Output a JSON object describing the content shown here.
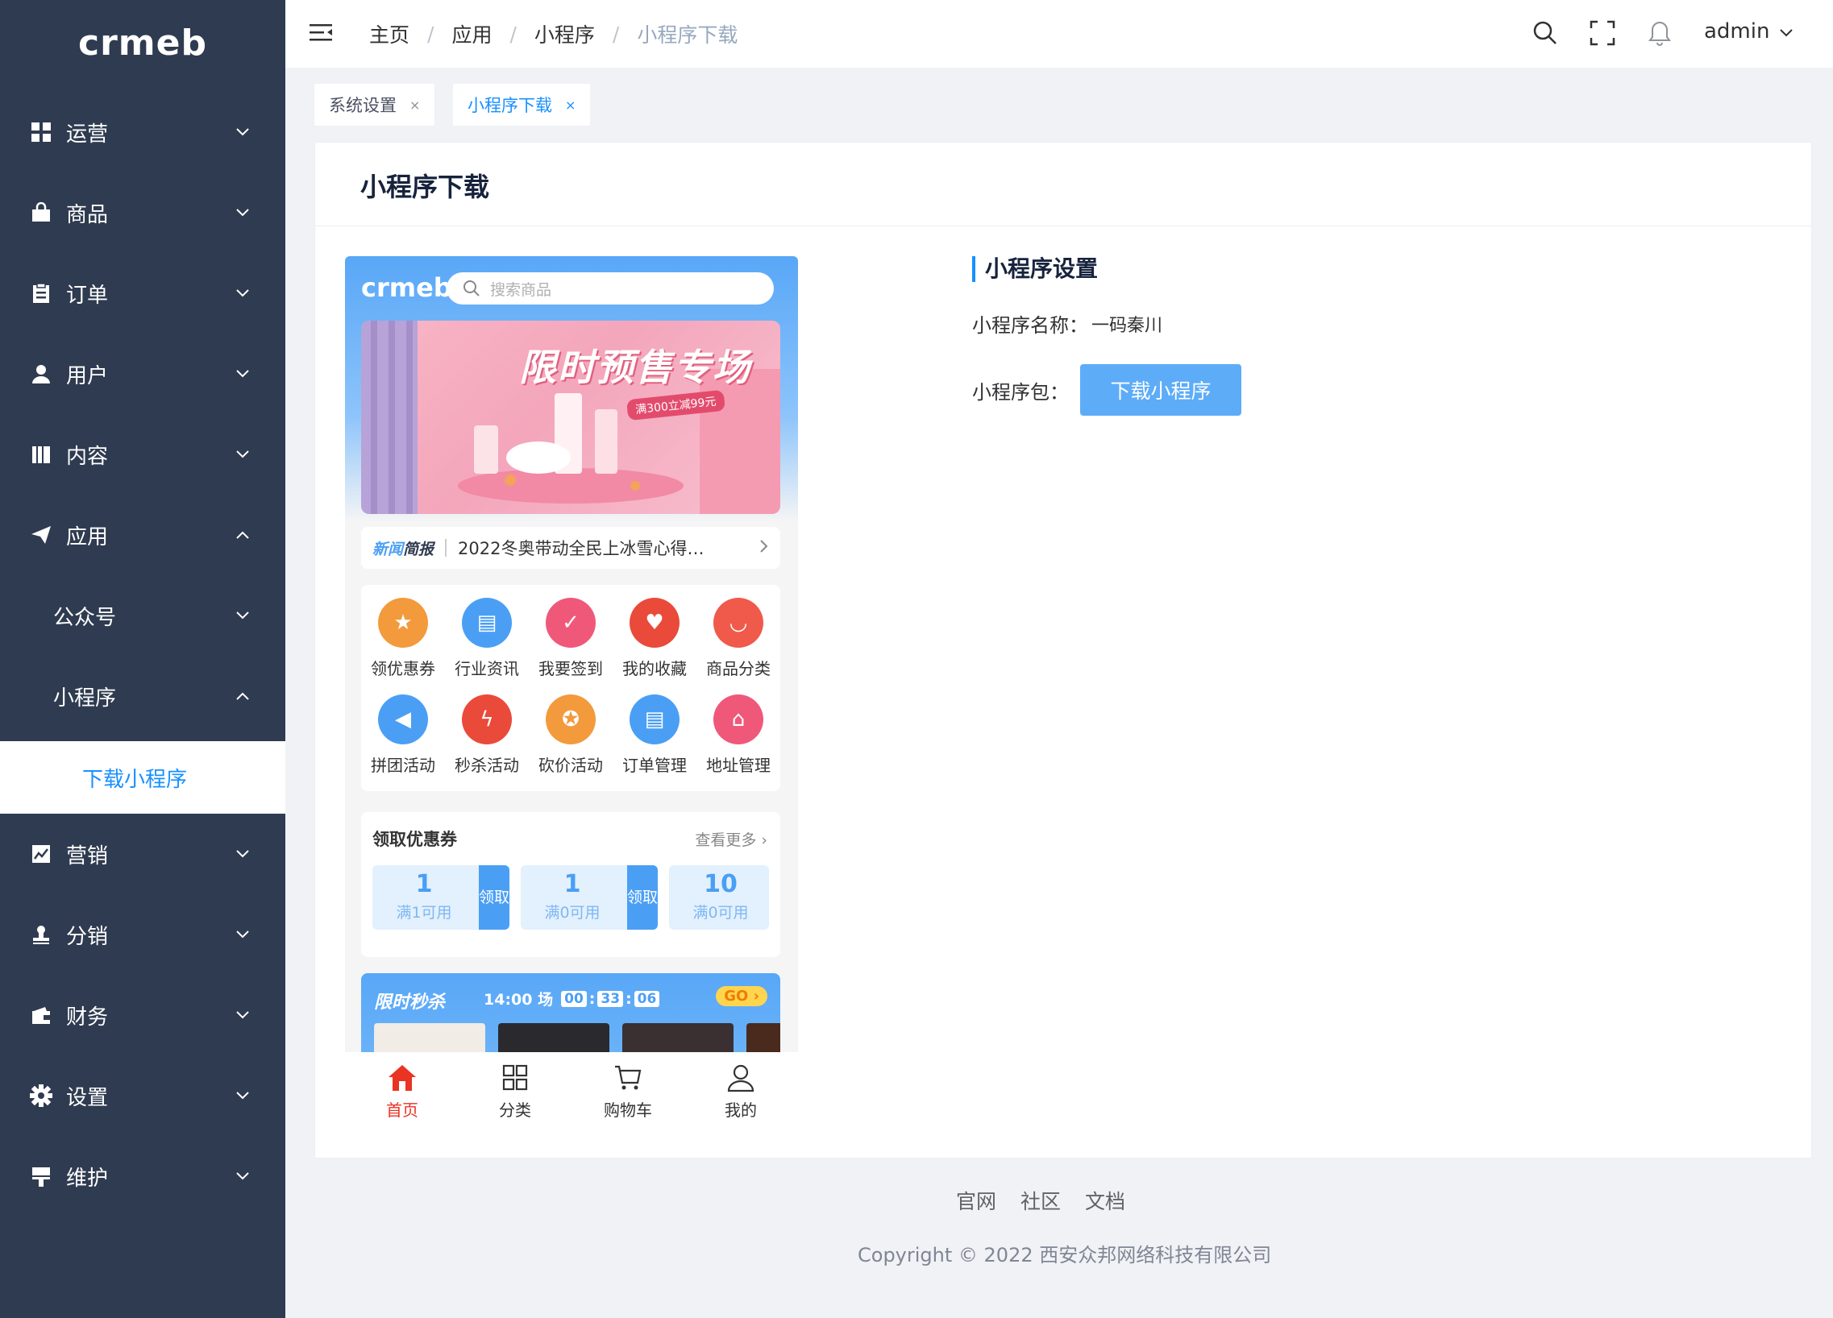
{
  "sidebar": {
    "logo": "crmeb",
    "items": [
      {
        "label": "运营",
        "icon": "grid-icon",
        "expanded": false
      },
      {
        "label": "商品",
        "icon": "bag-icon",
        "expanded": false
      },
      {
        "label": "订单",
        "icon": "clipboard-icon",
        "expanded": false
      },
      {
        "label": "用户",
        "icon": "user-icon",
        "expanded": false
      },
      {
        "label": "内容",
        "icon": "books-icon",
        "expanded": false
      },
      {
        "label": "应用",
        "icon": "paper-plane-icon",
        "expanded": true
      },
      {
        "label": "公众号",
        "expanded": false
      },
      {
        "label": "小程序",
        "expanded": true
      },
      {
        "label": "下载小程序",
        "active": true
      },
      {
        "label": "营销",
        "icon": "chart-icon",
        "expanded": false
      },
      {
        "label": "分销",
        "icon": "stamp-icon",
        "expanded": false
      },
      {
        "label": "财务",
        "icon": "wallet-icon",
        "expanded": false
      },
      {
        "label": "设置",
        "icon": "gear-icon",
        "expanded": false
      },
      {
        "label": "维护",
        "icon": "brush-icon",
        "expanded": false
      }
    ]
  },
  "header": {
    "breadcrumb": [
      "主页",
      "应用",
      "小程序",
      "小程序下载"
    ],
    "user": "admin"
  },
  "tags": [
    {
      "label": "系统设置",
      "active": false
    },
    {
      "label": "小程序下载",
      "active": true
    }
  ],
  "page": {
    "title": "小程序下载"
  },
  "preview": {
    "logo": "crmeb",
    "search_placeholder": "搜索商品",
    "banner_title": "限时预售专场",
    "banner_tag": "满300立减99元",
    "news_label_a": "新闻",
    "news_label_b": "简报",
    "news_text": "2022冬奥带动全民上冰雪心得…",
    "nav": [
      {
        "label": "领优惠券",
        "color": "#f39a3c"
      },
      {
        "label": "行业资讯",
        "color": "#4a9ff5"
      },
      {
        "label": "我要签到",
        "color": "#f0587a"
      },
      {
        "label": "我的收藏",
        "color": "#ea4a3a"
      },
      {
        "label": "商品分类",
        "color": "#f05a4a"
      },
      {
        "label": "拼团活动",
        "color": "#4a9ff5"
      },
      {
        "label": "秒杀活动",
        "color": "#ea4a3a"
      },
      {
        "label": "砍价活动",
        "color": "#f39a3c"
      },
      {
        "label": "订单管理",
        "color": "#4a9ff5"
      },
      {
        "label": "地址管理",
        "color": "#f0587a"
      }
    ],
    "coupon_title": "领取优惠券",
    "coupon_more": "查看更多",
    "coupons": [
      {
        "amount": "1",
        "cond": "满1可用",
        "take": "领取"
      },
      {
        "amount": "1",
        "cond": "满0可用",
        "take": "领取"
      },
      {
        "amount": "10",
        "cond": "满0可用",
        "take": ""
      }
    ],
    "flash_title": "限时秒杀",
    "flash_session": "14:00 场",
    "flash_h": "00",
    "flash_m": "33",
    "flash_s": "06",
    "flash_go": "GO",
    "tabbar": [
      {
        "label": "首页",
        "active": true
      },
      {
        "label": "分类",
        "active": false
      },
      {
        "label": "购物车",
        "active": false
      },
      {
        "label": "我的",
        "active": false
      }
    ]
  },
  "settings": {
    "title": "小程序设置",
    "name_label": "小程序名称：",
    "name_value": "一码秦川",
    "package_label": "小程序包：",
    "download_button": "下载小程序"
  },
  "footer": {
    "links": [
      "官网",
      "社区",
      "文档"
    ],
    "copyright": "Copyright © 2022 西安众邦网络科技有限公司"
  }
}
